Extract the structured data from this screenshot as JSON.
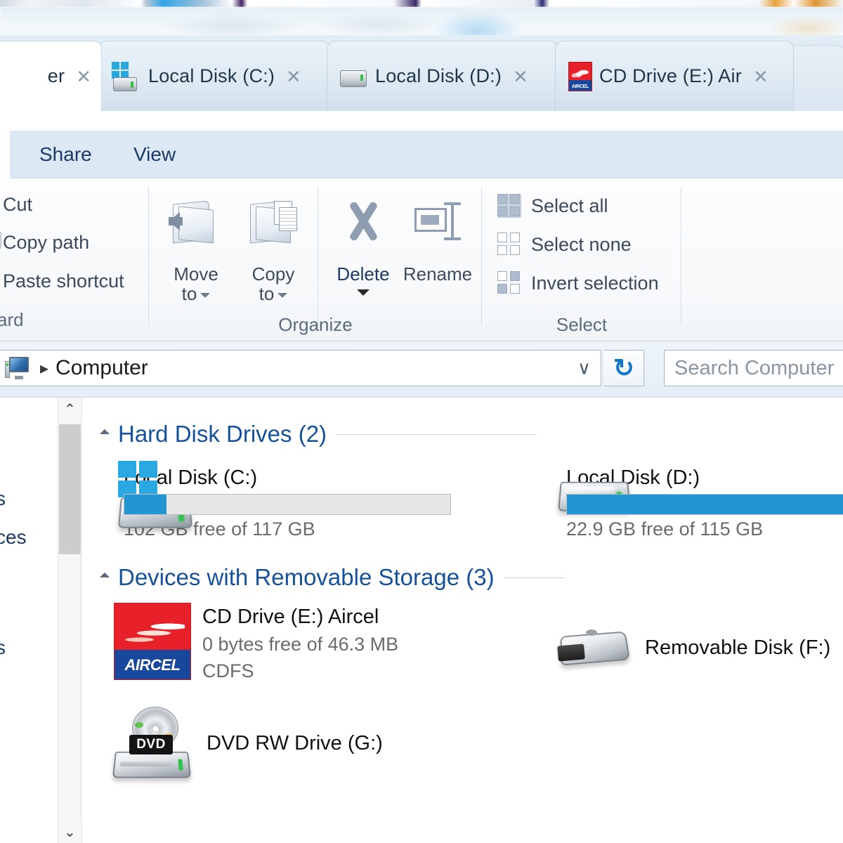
{
  "window": {
    "tabs": [
      {
        "label": "er",
        "icon": "none",
        "active": true,
        "close": "✕",
        "clipped": true
      },
      {
        "label": "Local Disk (C:)",
        "icon": "hdd-windows-icon",
        "active": false,
        "close": "✕"
      },
      {
        "label": "Local Disk (D:)",
        "icon": "hdd-icon",
        "active": false,
        "close": "✕"
      },
      {
        "label": "CD Drive (E:) Air",
        "icon": "aircel-disc-icon",
        "active": false,
        "close": "✕"
      }
    ]
  },
  "ribbon": {
    "tabs": [
      {
        "label": "Share",
        "active": false
      },
      {
        "label": "View",
        "active": false
      }
    ],
    "groups": [
      {
        "name": "clipboard",
        "label": "ard",
        "items": [
          {
            "label": "Cut"
          },
          {
            "label": "Copy path"
          },
          {
            "label": "Paste shortcut"
          }
        ]
      },
      {
        "name": "organize",
        "label": "Organize",
        "buttons": [
          {
            "label_line1": "Move",
            "label_line2": "to",
            "icon": "move-to-folder-icon",
            "dropdown": true
          },
          {
            "label_line1": "Copy",
            "label_line2": "to",
            "icon": "copy-to-folder-icon",
            "dropdown": true
          },
          {
            "label_line1": "Delete",
            "label_line2": "",
            "icon": "delete-x-icon",
            "dropdown": true
          },
          {
            "label_line1": "Rename",
            "label_line2": "",
            "icon": "rename-icon",
            "dropdown": false
          }
        ]
      },
      {
        "name": "select",
        "label": "Select",
        "items": [
          {
            "label": "Select all",
            "icon": "select-all-icon"
          },
          {
            "label": "Select none",
            "icon": "select-none-icon"
          },
          {
            "label": "Invert selection",
            "icon": "invert-selection-icon"
          }
        ]
      }
    ]
  },
  "address": {
    "icon": "computer-icon",
    "separator": "▸",
    "crumb": "Computer",
    "chevron": "∨",
    "refresh": "↻",
    "search_placeholder": "Search Computer"
  },
  "navpane": {
    "fragments": [
      "s",
      "ces",
      "s"
    ]
  },
  "scrollbar": {
    "up": "⌃",
    "down": "⌄"
  },
  "main": {
    "groups": [
      {
        "title": "Hard Disk Drives (2)",
        "collapsed": false,
        "items": [
          {
            "name": "Local Disk (C:)",
            "icon": "hdd-windows-icon",
            "capacity_text": "102 GB free of 117 GB",
            "fs": "",
            "bar_percent": 13
          },
          {
            "name": "Local Disk (D:)",
            "icon": "hdd-icon",
            "capacity_text": "22.9 GB free of 115 GB",
            "fs": "",
            "bar_percent": 100
          }
        ]
      },
      {
        "title": "Devices with Removable Storage (3)",
        "collapsed": false,
        "items": [
          {
            "name": "CD Drive (E:) Aircel",
            "icon": "aircel-disc-icon",
            "icon_text": "AIRCEL",
            "capacity_text": "0 bytes free of 46.3 MB",
            "fs": "CDFS",
            "bar_percent": null
          },
          {
            "name": "Removable Disk (F:)",
            "icon": "usb-drive-icon",
            "capacity_text": "",
            "fs": "",
            "bar_percent": null
          },
          {
            "name": "DVD RW Drive (G:)",
            "icon": "dvd-drive-icon",
            "icon_text": "DVD",
            "capacity_text": "",
            "fs": "",
            "bar_percent": null
          }
        ]
      }
    ]
  },
  "colors": {
    "bar_fill": "#2196d3",
    "bar_track": "#e6e6e6",
    "group_title": "#16519e",
    "ribbon_tab_bg": "#dce9f5",
    "aircel_red": "#e8202a",
    "aircel_blue": "#17489e"
  }
}
